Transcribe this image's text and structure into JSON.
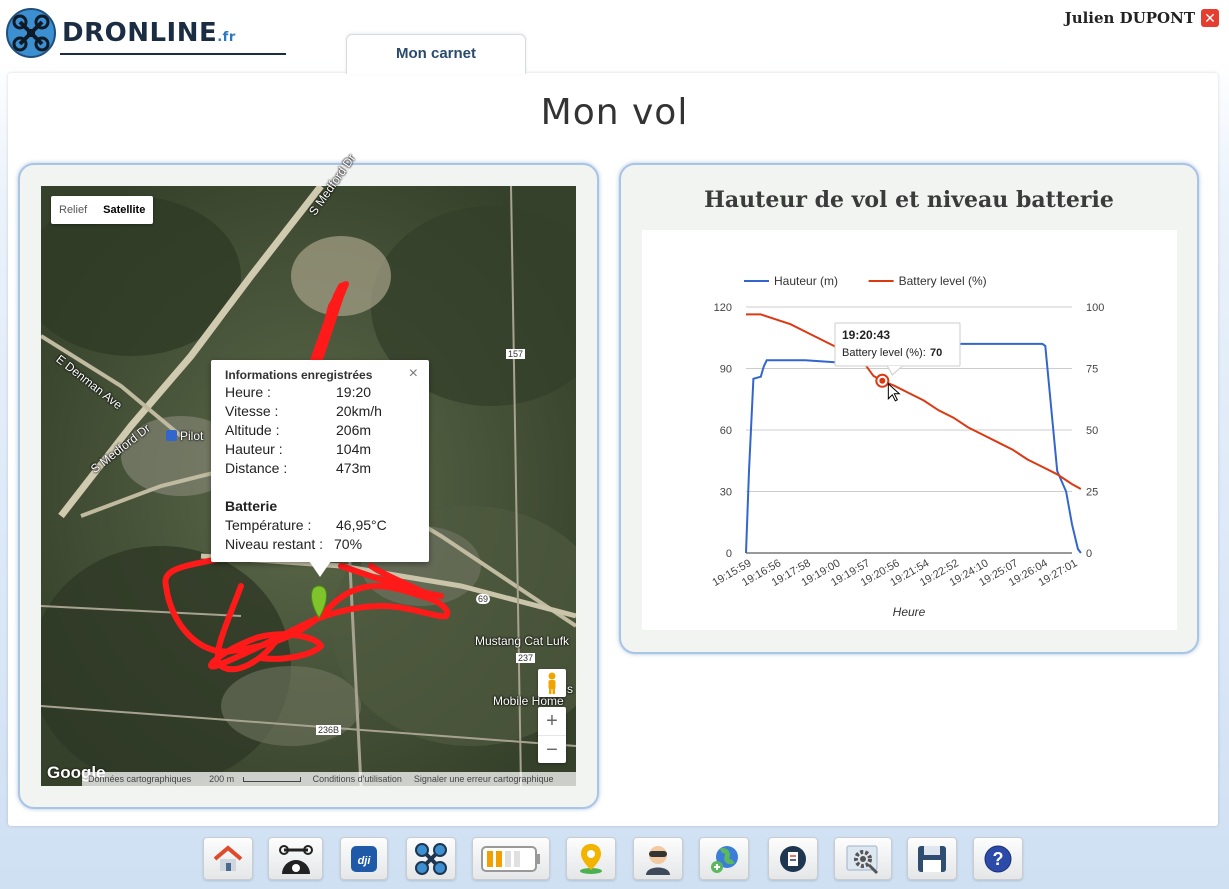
{
  "app": {
    "logo_text": "DRONLINE",
    "logo_suffix": ".fr",
    "user_name": "Julien DUPONT",
    "tab_label": "Mon carnet",
    "page_title": "Mon vol"
  },
  "map": {
    "type_buttons": [
      "Relief",
      "Satellite"
    ],
    "active_type": "Satellite",
    "labels": {
      "road1": "S Medford Dr",
      "road2": "E Denman Ave",
      "road3": "S Medford Dr",
      "poi1": "Pilot",
      "shield1": "157",
      "shield2": "69",
      "shield3": "237",
      "shield4": "236B",
      "poi2": "Mustang Cat Lufk",
      "poi3": "Mobile Home",
      "poi3b": "s"
    },
    "google": "Google",
    "footer": {
      "data": "Données cartographiques",
      "scale": "200 m",
      "terms": "Conditions d'utilisation",
      "report": "Signaler une erreur cartographique"
    },
    "zoom_in": "+",
    "zoom_out": "−",
    "info": {
      "title": "Informations enregistrées",
      "close": "×",
      "rows": [
        {
          "k": "Heure :",
          "v": "19:20"
        },
        {
          "k": "Vitesse :",
          "v": "20km/h"
        },
        {
          "k": "Altitude :",
          "v": "206m"
        },
        {
          "k": "Hauteur :",
          "v": "104m"
        },
        {
          "k": "Distance :",
          "v": "473m"
        }
      ],
      "battery_title": "Batterie",
      "battery_rows": [
        {
          "k": "Température :",
          "v": "46,95°C"
        },
        {
          "k": "Niveau restant :",
          "v": "70%"
        }
      ]
    }
  },
  "chart_data": {
    "type": "line",
    "title": "Hauteur de vol et niveau batterie",
    "xlabel": "Heure",
    "x_ticks": [
      "19:15:59",
      "19:16:56",
      "19:17:58",
      "19:19:00",
      "19:19:57",
      "19:20:56",
      "19:21:54",
      "19:22:52",
      "19:24:10",
      "19:25:07",
      "19:26:04",
      "19:27:01"
    ],
    "left_axis": {
      "ticks": [
        0,
        30,
        60,
        90,
        120
      ],
      "ylim": [
        0,
        120
      ]
    },
    "right_axis": {
      "ticks": [
        0,
        25,
        50,
        75,
        100
      ],
      "ylim": [
        0,
        100
      ]
    },
    "series": [
      {
        "name": "Hauteur (m)",
        "color": "#3366cc",
        "axis": "left",
        "points": [
          [
            0,
            0
          ],
          [
            0.1,
            40
          ],
          [
            0.25,
            85
          ],
          [
            0.5,
            86
          ],
          [
            0.6,
            91
          ],
          [
            0.7,
            94
          ],
          [
            1.0,
            94
          ],
          [
            2.0,
            94
          ],
          [
            3.0,
            93
          ],
          [
            3.6,
            94
          ],
          [
            4.0,
            97
          ],
          [
            4.5,
            101
          ],
          [
            5.0,
            102
          ],
          [
            6.0,
            102
          ],
          [
            7.0,
            102
          ],
          [
            8.0,
            102
          ],
          [
            9.0,
            102
          ],
          [
            10.0,
            102
          ],
          [
            10.1,
            101
          ],
          [
            10.5,
            40
          ],
          [
            10.8,
            30
          ],
          [
            11.0,
            14
          ],
          [
            11.2,
            2
          ],
          [
            11.3,
            0
          ]
        ]
      },
      {
        "name": "Battery level (%)",
        "color": "#dc3912",
        "axis": "right",
        "points": [
          [
            0,
            97
          ],
          [
            0.5,
            97
          ],
          [
            1.0,
            95
          ],
          [
            1.5,
            93
          ],
          [
            2.0,
            90
          ],
          [
            2.5,
            87
          ],
          [
            3.0,
            84
          ],
          [
            3.5,
            81
          ],
          [
            4.0,
            77
          ],
          [
            4.3,
            72
          ],
          [
            4.6,
            70
          ],
          [
            5.0,
            68
          ],
          [
            5.5,
            65
          ],
          [
            6.0,
            62
          ],
          [
            6.5,
            58
          ],
          [
            7.0,
            55
          ],
          [
            7.5,
            51
          ],
          [
            8.0,
            48
          ],
          [
            8.5,
            45
          ],
          [
            9.0,
            42
          ],
          [
            9.5,
            38
          ],
          [
            10.0,
            35
          ],
          [
            10.5,
            32
          ],
          [
            11.0,
            28
          ],
          [
            11.3,
            26
          ]
        ]
      }
    ],
    "legend_position": "top",
    "tooltip": {
      "time": "19:20:43",
      "label": "Battery level (%): ",
      "value": "70",
      "series": "Battery level (%)",
      "x": 4.6
    }
  },
  "toolbar": {
    "icons": [
      "home-icon",
      "drone-weather-icon",
      "dji-icon",
      "drone-icon",
      "battery-icon",
      "map-pin-icon",
      "pilot-icon",
      "globe-icon",
      "logbook-icon",
      "settings-icon",
      "save-icon",
      "help-icon"
    ]
  },
  "colors": {
    "accent": "#2a4a6e",
    "panel_border": "#a9c5e6",
    "flight_path": "#ff1a1a"
  }
}
